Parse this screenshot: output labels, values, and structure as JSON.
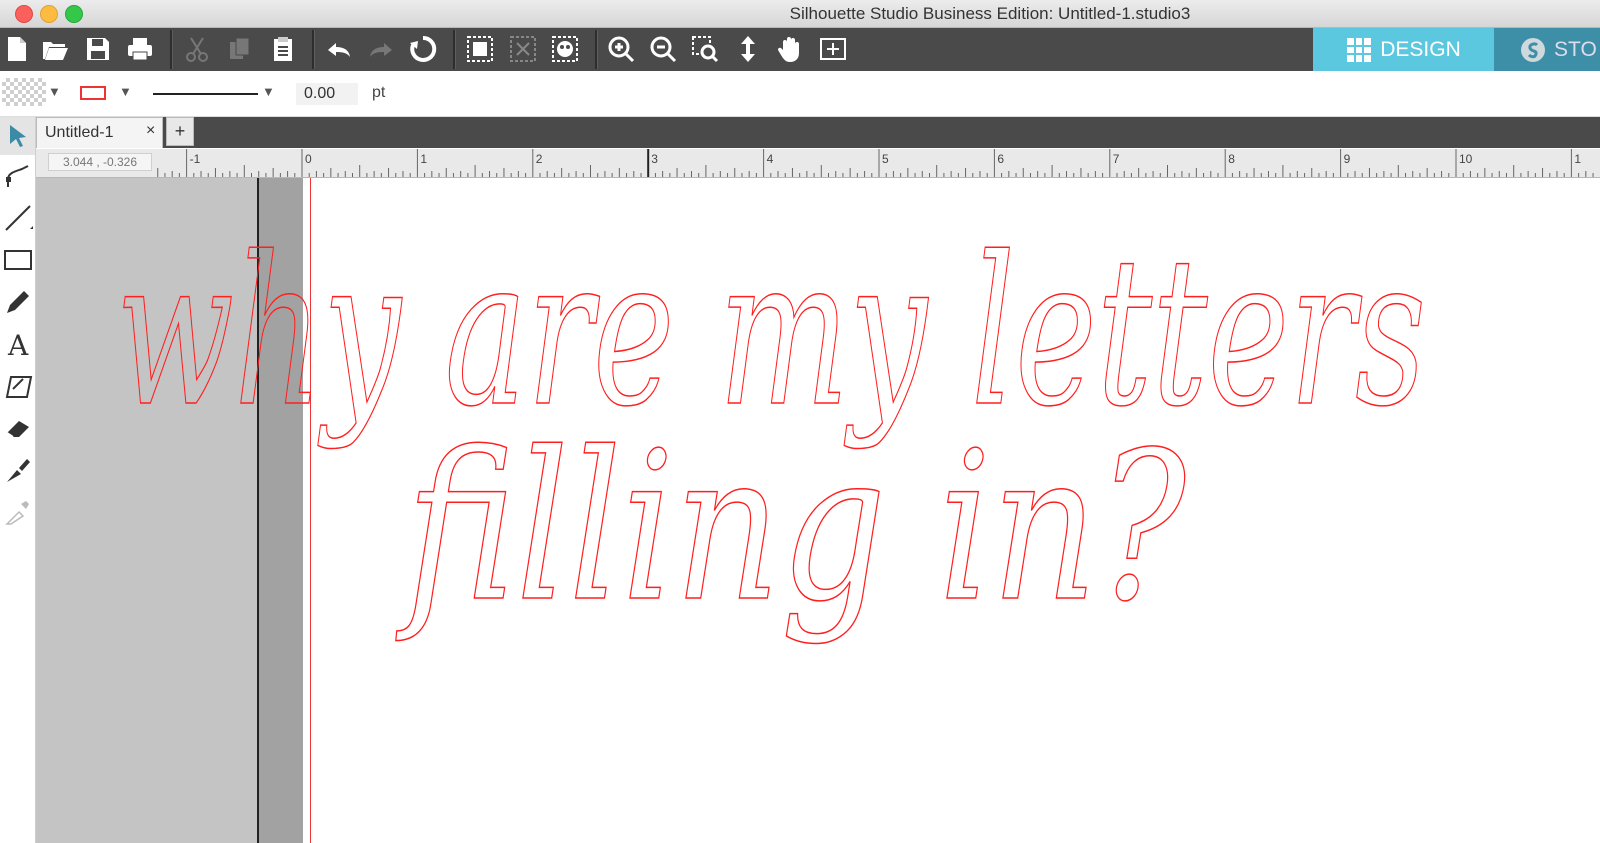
{
  "window": {
    "title": "Silhouette Studio Business Edition: Untitled-1.studio3"
  },
  "toolbar": {
    "icons": [
      "new-file-icon",
      "open-folder-icon",
      "save-icon",
      "print-icon",
      "cut-icon",
      "copy-icon",
      "paste-icon",
      "undo-icon",
      "redo-icon",
      "replicate-icon",
      "group-icon",
      "ungroup-icon",
      "compound-path-icon",
      "zoom-in-icon",
      "zoom-out-icon",
      "zoom-select-icon",
      "pan-move-icon",
      "hand-icon",
      "fit-to-page-icon"
    ],
    "mode_design": "DESIGN",
    "mode_store": "STO"
  },
  "properties": {
    "line_width_value": "0.00",
    "line_width_unit": "pt",
    "line_color": "#ee2222"
  },
  "tabs": {
    "doc_tab": "Untitled-1",
    "close": "×",
    "add": "+"
  },
  "ruler": {
    "coordinates": "3.044 , -0.326",
    "labels": [
      "-1",
      "0",
      "1",
      "2",
      "3",
      "4",
      "5",
      "6",
      "7",
      "8",
      "9",
      "10",
      "1"
    ]
  },
  "canvas": {
    "line1": "why are my letters",
    "line2": "filling in?",
    "text_color": "#ff1f1f"
  }
}
